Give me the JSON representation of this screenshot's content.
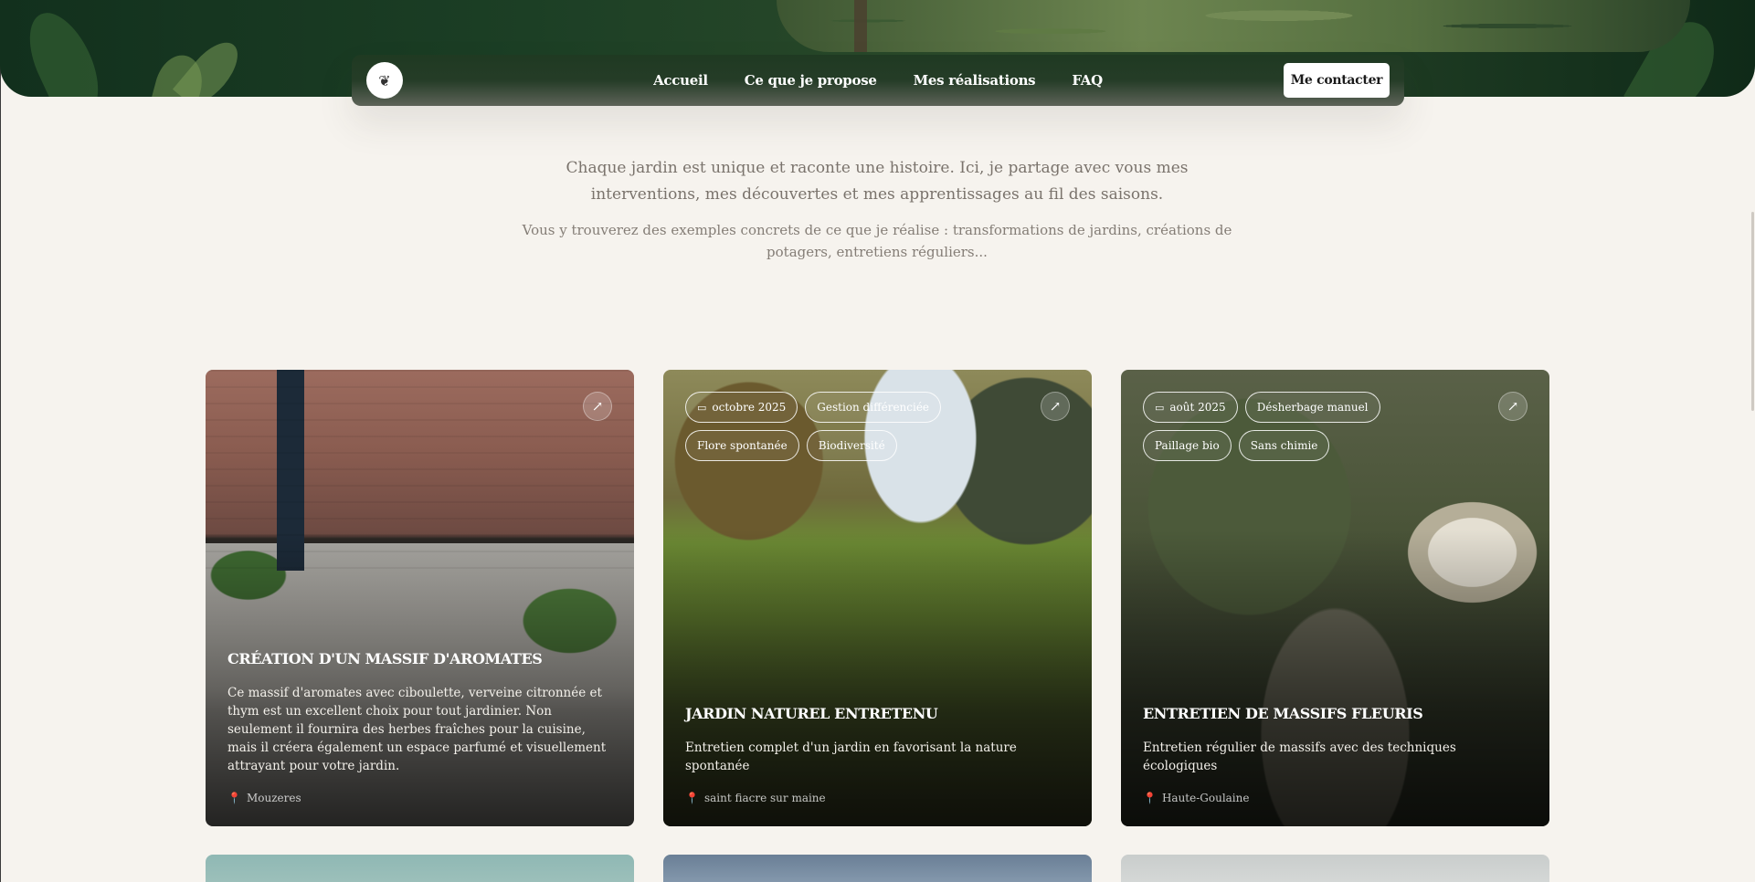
{
  "nav": {
    "logo_glyph": "❦",
    "links": [
      "Accueil",
      "Ce que je propose",
      "Mes réalisations",
      "FAQ"
    ],
    "cta_label": "Me contacter"
  },
  "intro": {
    "paragraph1": "Chaque jardin est unique et raconte une histoire. Ici, je partage avec vous mes interventions, mes découvertes et mes apprentissages au fil des saisons.",
    "paragraph2": "Vous y trouverez des exemples concrets de ce que je réalise : transformations de jardins, créations de potagers, entretiens réguliers..."
  },
  "cards": [
    {
      "tags": [],
      "title": "Création d'un massif d'aromates",
      "description": "Ce massif d'aromates avec ciboulette, verveine citronnée et thym est un excellent choix pour tout jardinier. Non seulement il fournira des herbes fraîches pour la cuisine, mais il créera également un espace parfumé et visuellement attrayant pour votre jardin.",
      "location": "Mouzeres"
    },
    {
      "tags": [
        {
          "label": "octobre 2025",
          "icon": "calendar-icon"
        },
        {
          "label": "Gestion différenciée"
        },
        {
          "label": "Flore spontanée"
        },
        {
          "label": "Biodiversité"
        }
      ],
      "title": "Jardin naturel entretenu",
      "description": "Entretien complet d'un jardin en favorisant la nature spontanée",
      "location": "saint fiacre sur maine"
    },
    {
      "tags": [
        {
          "label": "août 2025",
          "icon": "calendar-icon"
        },
        {
          "label": "Désherbage manuel"
        },
        {
          "label": "Paillage bio"
        },
        {
          "label": "Sans chimie"
        }
      ],
      "title": "Entretien de massifs fleuris",
      "description": "Entretien régulier de massifs avec des techniques écologiques",
      "location": "Haute-Goulaine"
    }
  ],
  "icons": {
    "arrow": "↗",
    "calendar": "▭",
    "pin": "📍"
  }
}
